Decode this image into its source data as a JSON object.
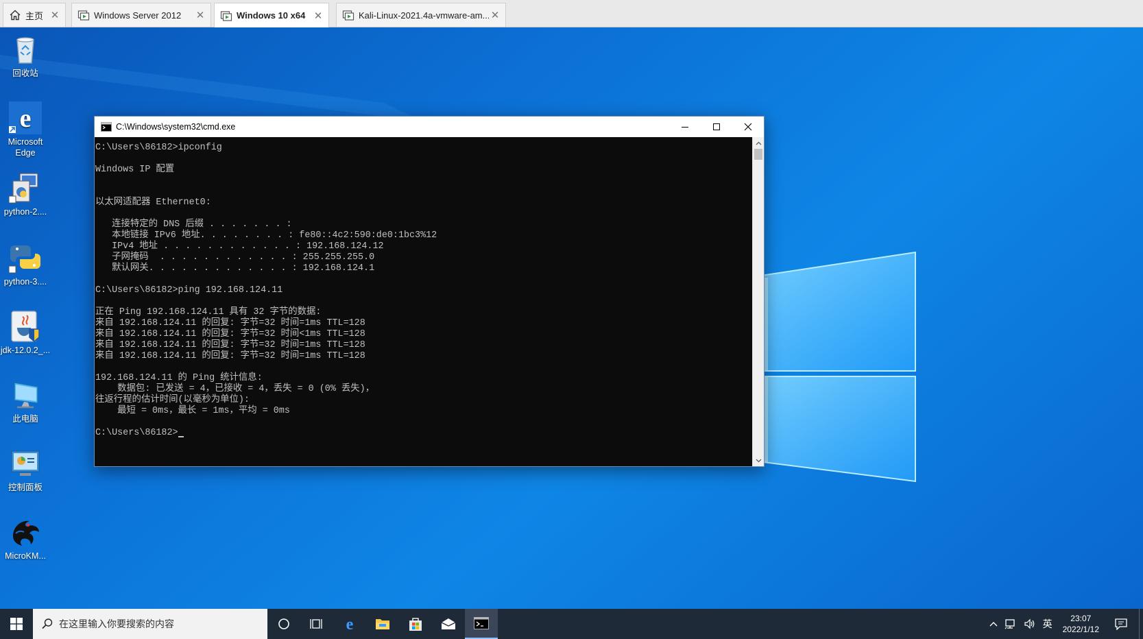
{
  "tabs": [
    {
      "label": "主页",
      "icon": "home-icon",
      "active": false
    },
    {
      "label": "Windows Server 2012",
      "icon": "vm-icon",
      "active": false
    },
    {
      "label": "Windows 10 x64",
      "icon": "vm-icon",
      "active": true
    },
    {
      "label": "Kali-Linux-2021.4a-vmware-am...",
      "icon": "vm-icon",
      "active": false
    }
  ],
  "desktop_icons": [
    {
      "label": "回收站",
      "icon": "recycle-bin-icon"
    },
    {
      "label": "Microsoft Edge",
      "icon": "edge-icon"
    },
    {
      "label": "python-2....",
      "icon": "python-installer-icon"
    },
    {
      "label": "python-3....",
      "icon": "python-icon"
    },
    {
      "label": "jdk-12.0.2_...",
      "icon": "java-installer-icon"
    },
    {
      "label": "此电脑",
      "icon": "this-pc-icon"
    },
    {
      "label": "控制面板",
      "icon": "control-panel-icon"
    },
    {
      "label": "MicroKM...",
      "icon": "microkms-icon"
    }
  ],
  "cmd": {
    "title": "C:\\Windows\\system32\\cmd.exe",
    "lines": [
      "C:\\Users\\86182>ipconfig",
      "",
      "Windows IP 配置",
      "",
      "",
      "以太网适配器 Ethernet0:",
      "",
      "   连接特定的 DNS 后缀 . . . . . . . :",
      "   本地链接 IPv6 地址. . . . . . . . : fe80::4c2:590:de0:1bc3%12",
      "   IPv4 地址 . . . . . . . . . . . . : 192.168.124.12",
      "   子网掩码  . . . . . . . . . . . . : 255.255.255.0",
      "   默认网关. . . . . . . . . . . . . : 192.168.124.1",
      "",
      "C:\\Users\\86182>ping 192.168.124.11",
      "",
      "正在 Ping 192.168.124.11 具有 32 字节的数据:",
      "来自 192.168.124.11 的回复: 字节=32 时间=1ms TTL=128",
      "来自 192.168.124.11 的回复: 字节=32 时间<1ms TTL=128",
      "来自 192.168.124.11 的回复: 字节=32 时间=1ms TTL=128",
      "来自 192.168.124.11 的回复: 字节=32 时间=1ms TTL=128",
      "",
      "192.168.124.11 的 Ping 统计信息:",
      "    数据包: 已发送 = 4，已接收 = 4，丢失 = 0 (0% 丢失)，",
      "往返行程的估计时间(以毫秒为单位):",
      "    最短 = 0ms，最长 = 1ms，平均 = 0ms",
      ""
    ],
    "prompt": "C:\\Users\\86182>"
  },
  "taskbar": {
    "search_placeholder": "在这里输入你要搜索的内容",
    "apps": [
      "cortana-icon",
      "task-view-icon",
      "edge-icon",
      "file-explorer-icon",
      "store-icon",
      "mail-icon",
      "cmd-icon"
    ],
    "active_app": "cmd-icon",
    "ime": "英",
    "time": "23:07",
    "date": "2022/1/12"
  },
  "colors": {
    "desktop_blue": "#0c73d8",
    "console_bg": "#0c0c0c",
    "console_text": "#c0c0c0",
    "taskbar": "#1f2a38"
  }
}
